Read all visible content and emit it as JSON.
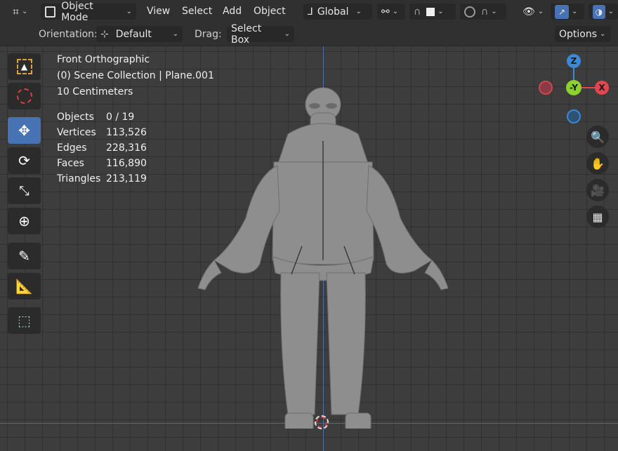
{
  "header": {
    "mode_label": "Object Mode",
    "menus": [
      "View",
      "Select",
      "Add",
      "Object"
    ],
    "transform_orientation": "Global"
  },
  "toolheader": {
    "orientation_label": "Orientation:",
    "orientation_value": "Default",
    "drag_label": "Drag:",
    "drag_value": "Select Box",
    "options_label": "Options"
  },
  "viewport": {
    "view_name": "Front Orthographic",
    "collection": "(0) Scene Collection | Plane.001",
    "scale": "10 Centimeters",
    "stats": [
      {
        "label": "Objects",
        "value": "0 / 19"
      },
      {
        "label": "Vertices",
        "value": "113,526"
      },
      {
        "label": "Edges",
        "value": "228,316"
      },
      {
        "label": "Faces",
        "value": "116,890"
      },
      {
        "label": "Triangles",
        "value": "213,119"
      }
    ]
  },
  "gizmo": {
    "z": "Z",
    "y": "-Y",
    "x": "X"
  },
  "colors": {
    "accent": "#4772b3",
    "x_axis": "#e4454f",
    "y_axis": "#8bd22e",
    "z_axis": "#3b88d6",
    "header_bg": "#303030",
    "viewport_bg": "#3d3d3d"
  },
  "tools": [
    "select-box-tool",
    "cursor-tool",
    "move-tool",
    "rotate-tool",
    "scale-tool",
    "transform-tool",
    "annotate-tool",
    "measure-tool",
    "add-cube-tool"
  ]
}
